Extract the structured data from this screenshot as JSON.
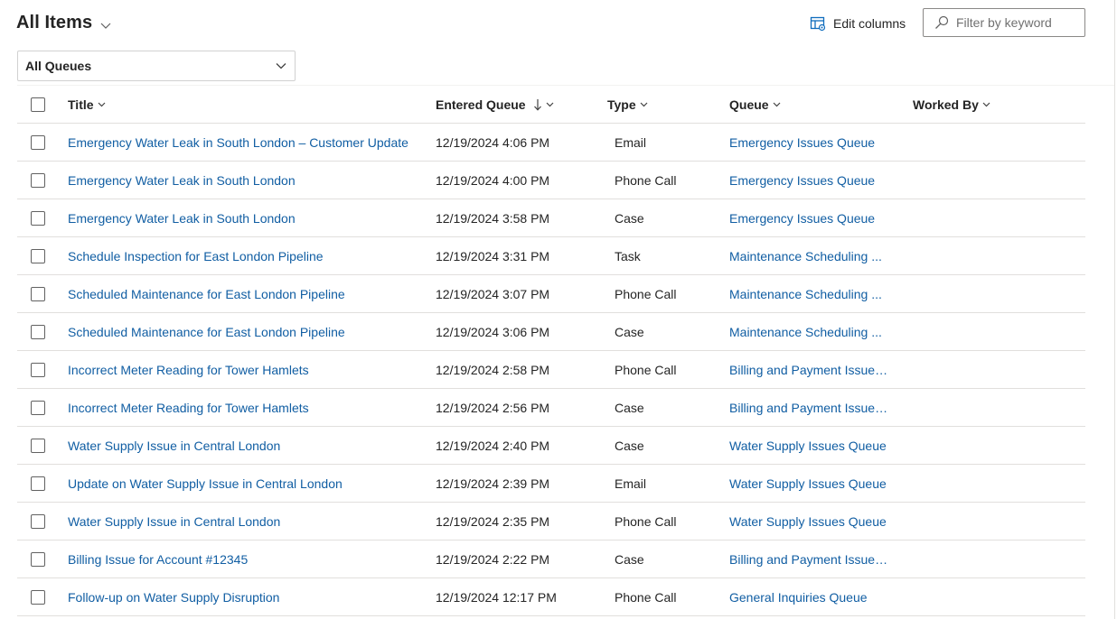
{
  "header": {
    "view_title": "All Items",
    "edit_columns_label": "Edit columns",
    "filter_placeholder": "Filter by keyword"
  },
  "queue_filter": {
    "selected": "All Queues"
  },
  "columns": {
    "title": "Title",
    "entered_queue": "Entered Queue",
    "type": "Type",
    "queue": "Queue",
    "worked_by": "Worked By"
  },
  "rows": [
    {
      "title": "Emergency Water Leak in South London – Customer Update",
      "entered": "12/19/2024 4:06 PM",
      "type": "Email",
      "queue": "Emergency Issues Queue",
      "worked_by": ""
    },
    {
      "title": "Emergency Water Leak in South London",
      "entered": "12/19/2024 4:00 PM",
      "type": "Phone Call",
      "queue": "Emergency Issues Queue",
      "worked_by": ""
    },
    {
      "title": "Emergency Water Leak in South London",
      "entered": "12/19/2024 3:58 PM",
      "type": "Case",
      "queue": "Emergency Issues Queue",
      "worked_by": ""
    },
    {
      "title": "Schedule Inspection for East London Pipeline",
      "entered": "12/19/2024 3:31 PM",
      "type": "Task",
      "queue": "Maintenance Scheduling ...",
      "worked_by": ""
    },
    {
      "title": "Scheduled Maintenance for East London Pipeline",
      "entered": "12/19/2024 3:07 PM",
      "type": "Phone Call",
      "queue": "Maintenance Scheduling ...",
      "worked_by": ""
    },
    {
      "title": "Scheduled Maintenance for East London Pipeline",
      "entered": "12/19/2024 3:06 PM",
      "type": "Case",
      "queue": "Maintenance Scheduling ...",
      "worked_by": ""
    },
    {
      "title": "Incorrect Meter Reading for Tower Hamlets",
      "entered": "12/19/2024 2:58 PM",
      "type": "Phone Call",
      "queue": "Billing and Payment Issues...",
      "worked_by": ""
    },
    {
      "title": "Incorrect Meter Reading for Tower Hamlets",
      "entered": "12/19/2024 2:56 PM",
      "type": "Case",
      "queue": "Billing and Payment Issues...",
      "worked_by": ""
    },
    {
      "title": "Water Supply Issue in Central London",
      "entered": "12/19/2024 2:40 PM",
      "type": "Case",
      "queue": "Water Supply Issues Queue",
      "worked_by": ""
    },
    {
      "title": "Update on Water Supply Issue in Central London",
      "entered": "12/19/2024 2:39 PM",
      "type": "Email",
      "queue": "Water Supply Issues Queue",
      "worked_by": ""
    },
    {
      "title": "Water Supply Issue in Central London",
      "entered": "12/19/2024 2:35 PM",
      "type": "Phone Call",
      "queue": "Water Supply Issues Queue",
      "worked_by": ""
    },
    {
      "title": "Billing Issue for Account #12345",
      "entered": "12/19/2024 2:22 PM",
      "type": "Case",
      "queue": "Billing and Payment Issues...",
      "worked_by": ""
    },
    {
      "title": "Follow-up on Water Supply Disruption",
      "entered": "12/19/2024 12:17 PM",
      "type": "Phone Call",
      "queue": "General Inquiries Queue",
      "worked_by": ""
    }
  ],
  "sort": {
    "column": "entered_queue",
    "direction": "descending"
  },
  "colors": {
    "link": "#115ea3",
    "text": "#242424",
    "border": "#e1dfdd"
  }
}
